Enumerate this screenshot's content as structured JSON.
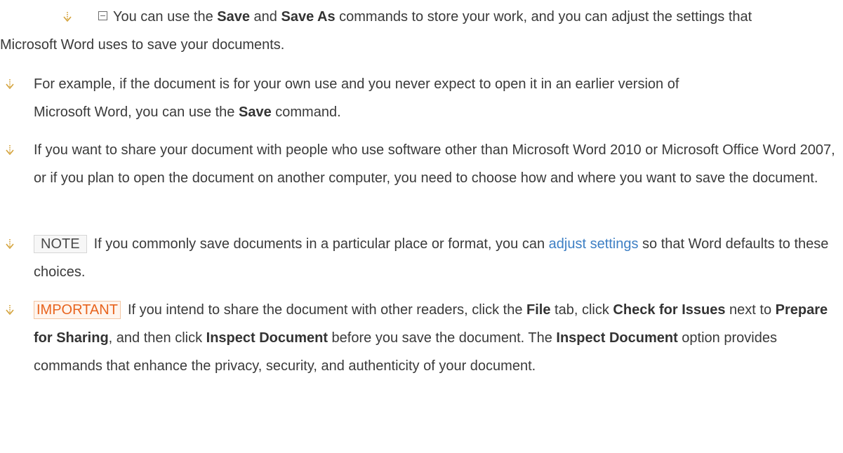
{
  "colors": {
    "text": "#3a3a3a",
    "bullet_arrow": "#d4a23a",
    "link": "#3d7fc4",
    "important_text": "#e8641e",
    "important_border": "#f3c6a3",
    "note_border": "#d6d6d6"
  },
  "paragraphs": {
    "p1": {
      "icon": "collapse-box-icon",
      "t1": "You can use the ",
      "b1": "Save",
      "t2": " and ",
      "b2": "Save As",
      "t3": " commands to store your work, and you can adjust the settings that Microsoft Word uses to save your documents."
    },
    "p2": {
      "t1": "For example, if the document is for your own use and you never expect to open it in an earlier version of Microsoft Word, you can use the ",
      "b1": "Save",
      "t2": " command."
    },
    "p3": {
      "t1": "If you want to share your document with people who use software other than Microsoft Word 2010 or Microsoft Office Word 2007, or if you plan to open the document on another computer, you need to choose how and where you want to save the document."
    },
    "p4": {
      "label": "NOTE",
      "t1": "If you commonly save documents in a particular place or format, you can ",
      "link": "adjust settings",
      "t2": " so that Word defaults to these choices."
    },
    "p5": {
      "label": "IMPORTANT",
      "t1": "If you intend to share the document with other readers, click the ",
      "b1": "File",
      "t2": " tab, click ",
      "b2": "Check for Issues",
      "t3": " next to ",
      "b3": "Prepare for Sharing",
      "t4": ", and then click ",
      "b4": "Inspect Document",
      "t5": " before you save the document. The ",
      "b5": "Inspect Document",
      "t6": " option provides commands that enhance the privacy, security, and authenticity of your document."
    }
  }
}
